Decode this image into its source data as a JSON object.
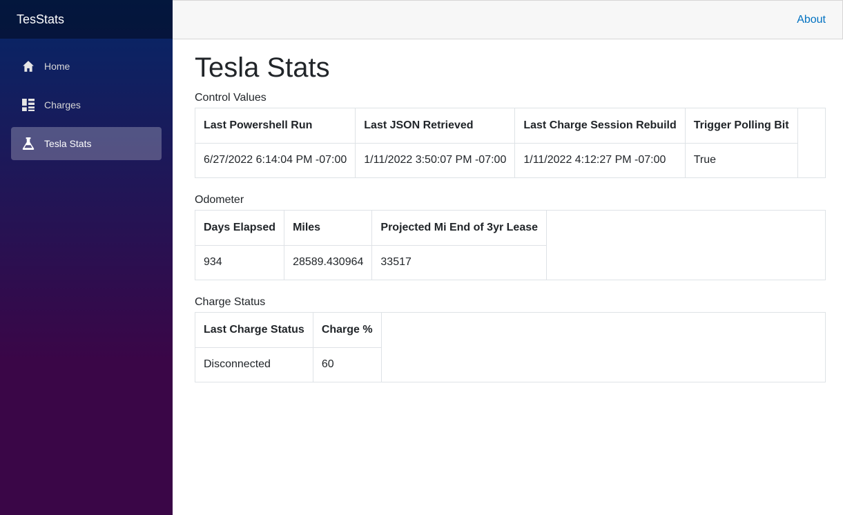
{
  "brand": "TesStats",
  "nav": [
    {
      "label": "Home",
      "icon": "home-icon"
    },
    {
      "label": "Charges",
      "icon": "list-icon"
    },
    {
      "label": "Tesla Stats",
      "icon": "beaker-icon"
    }
  ],
  "top_row": {
    "about": "About"
  },
  "page_title": "Tesla Stats",
  "control_values": {
    "title": "Control Values",
    "headers": [
      "Last Powershell Run",
      "Last JSON Retrieved",
      "Last Charge Session Rebuild",
      "Trigger Polling Bit"
    ],
    "row": [
      "6/27/2022 6:14:04 PM -07:00",
      "1/11/2022 3:50:07 PM -07:00",
      "1/11/2022 4:12:27 PM -07:00",
      "True"
    ]
  },
  "odometer": {
    "title": "Odometer",
    "headers": [
      "Days Elapsed",
      "Miles",
      "Projected Mi End of 3yr Lease"
    ],
    "row": [
      "934",
      "28589.430964",
      "33517"
    ]
  },
  "charge_status": {
    "title": "Charge Status",
    "headers": [
      "Last Charge Status",
      "Charge %"
    ],
    "row": [
      "Disconnected",
      "60"
    ]
  },
  "colors": {
    "sidebar_top": "#052767",
    "sidebar_bottom": "#3a0647",
    "link": "#0071c1"
  }
}
